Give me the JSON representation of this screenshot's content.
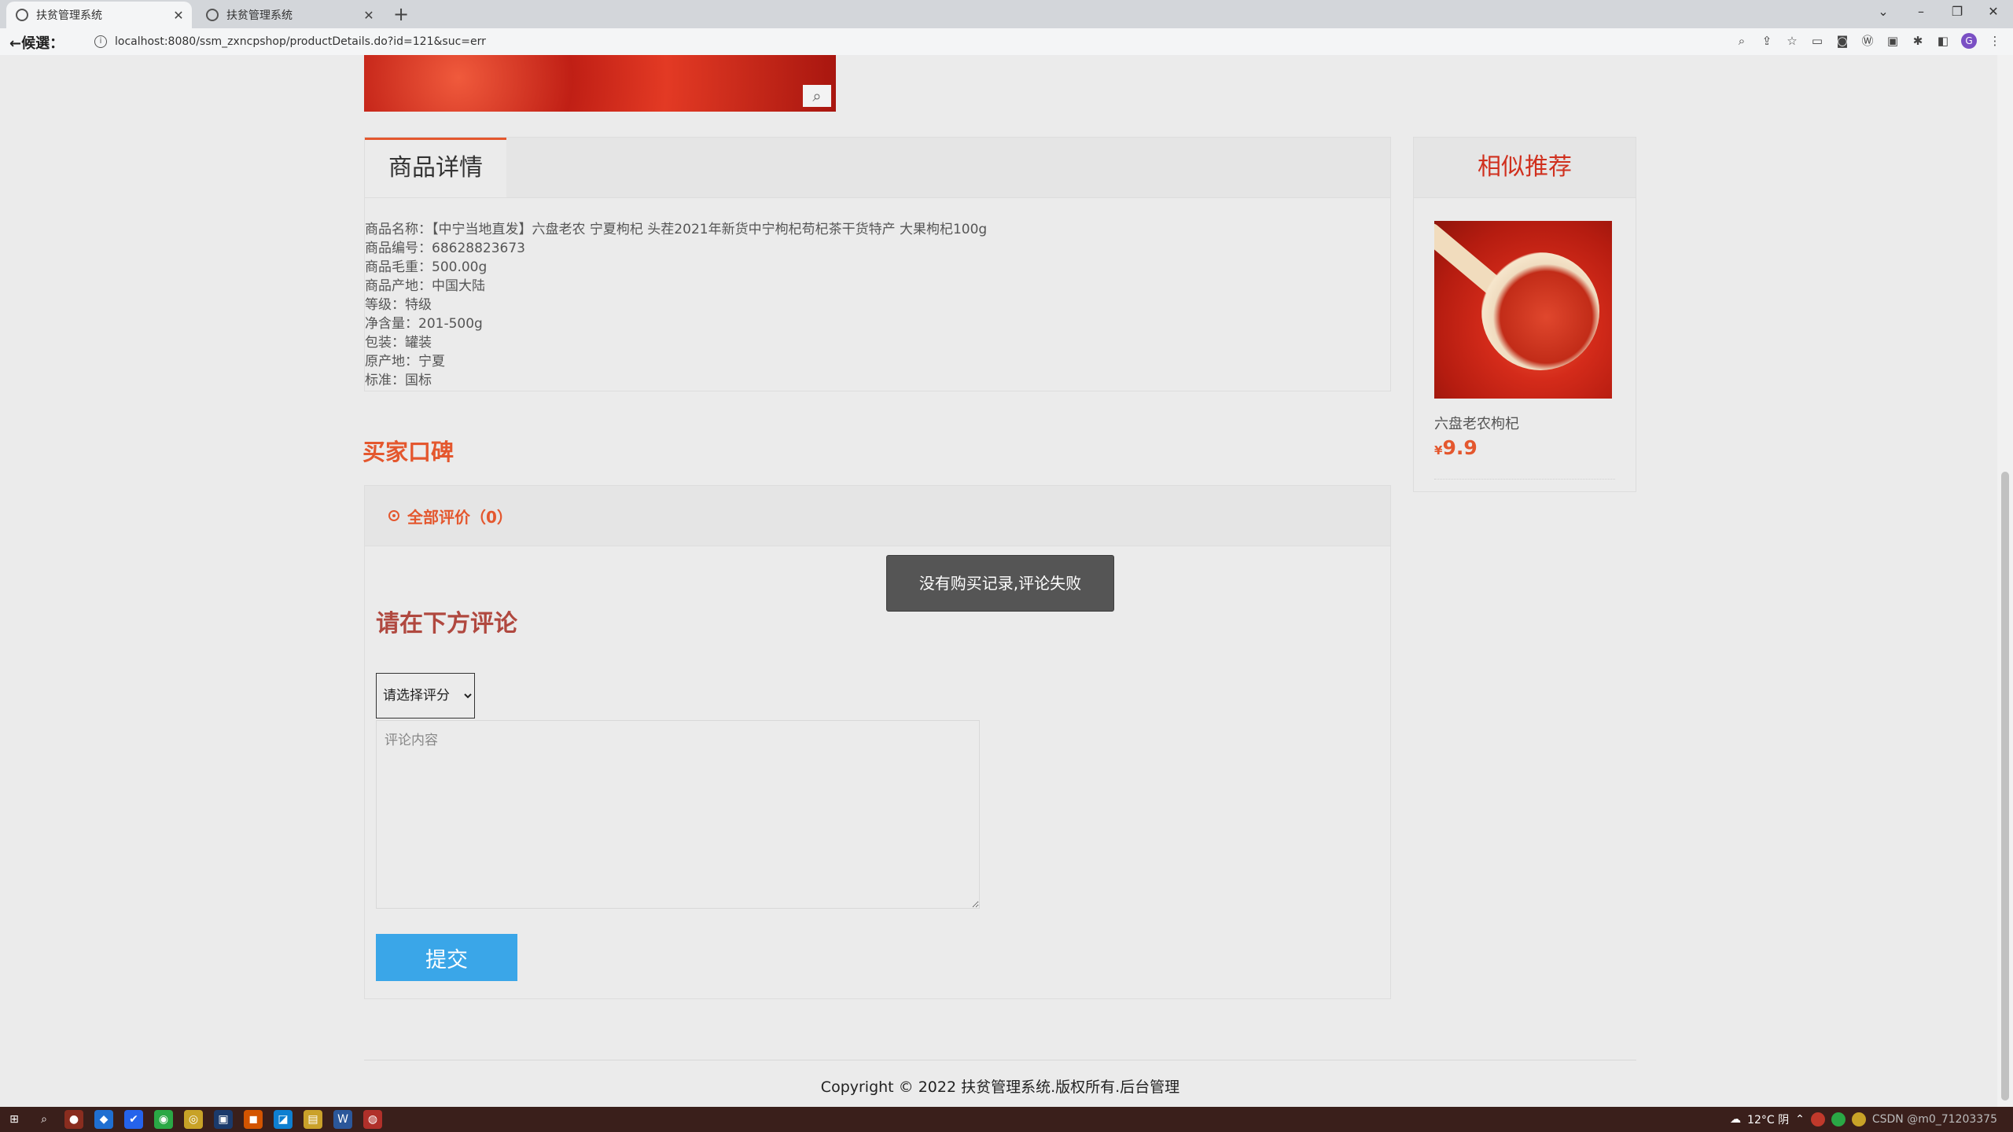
{
  "browser": {
    "tabs": [
      {
        "title": "扶贫管理系统",
        "active": true
      },
      {
        "title": "扶贫管理系统",
        "active": false
      }
    ],
    "new_tab": "+",
    "nav_label": "←候選：",
    "url": "localhost:8080/ssm_zxncpshop/productDetails.do?id=121&suc=err",
    "profile_letter": "G",
    "window_controls": [
      "⌄",
      "–",
      "❐",
      "✕"
    ]
  },
  "detail": {
    "tab_label": "商品详情",
    "lines": [
      "商品名称：【中宁当地直发】六盘老农 宁夏枸杞 头茬2021年新货中宁枸杞苟杞茶干货特产 大果枸杞100g",
      "商品编号：68628823673",
      "商品毛重：500.00g",
      "商品产地：中国大陆",
      "等级：特级",
      "净含量：201-500g",
      "包装：罐装",
      "原产地：宁夏",
      "标准：国标"
    ]
  },
  "reviews": {
    "heading": "买家口碑",
    "filter_label": "全部评价（0）",
    "comment_title": "请在下方评论",
    "rating_placeholder": "请选择评分",
    "comment_placeholder": "评论内容",
    "submit_label": "提交"
  },
  "toast": "没有购买记录,评论失败",
  "recommend": {
    "heading": "相似推荐",
    "item_name": "六盘老农枸杞",
    "currency": "¥",
    "price": "9.9"
  },
  "footer": {
    "copyright": "Copyright © 2022 扶贫管理系统.版权所有.后台管理"
  },
  "taskbar": {
    "weather": "12°C 阴",
    "watermark": "CSDN @m0_71203375"
  },
  "colors": {
    "accent": "#e4572e",
    "recommend_title": "#d0301e",
    "button_blue": "#3aa6e8"
  }
}
